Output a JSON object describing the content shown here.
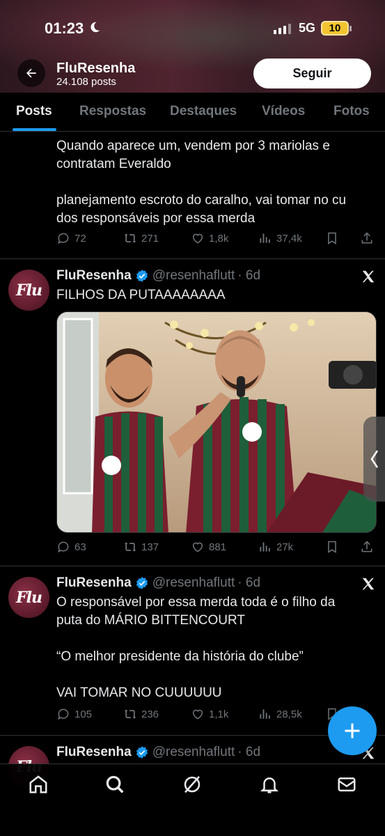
{
  "status_bar": {
    "time": "01:23",
    "network": "5G",
    "battery": "10"
  },
  "header": {
    "name": "FluResenha",
    "posts": "24.108 posts",
    "follow_label": "Seguir"
  },
  "tabs": [
    "Posts",
    "Respostas",
    "Destaques",
    "Vídeos",
    "Fotos"
  ],
  "posts": [
    {
      "lines": [
        "Quando aparece um, vendem por 3 mariolas e",
        "contratam Everaldo",
        "",
        "planejamento escroto do caralho, vai tomar no cu",
        "dos responsáveis por essa merda"
      ],
      "replies": "72",
      "reposts": "271",
      "likes": "1,8k",
      "views": "37,4k"
    },
    {
      "name": "FluResenha",
      "handle": "@resenhaflutt",
      "time": "· 6d",
      "lines": [
        "FILHOS DA PUTAAAAAAAA"
      ],
      "replies": "63",
      "reposts": "137",
      "likes": "881",
      "views": "27k",
      "media_description": "photo"
    },
    {
      "name": "FluResenha",
      "handle": "@resenhaflutt",
      "time": "· 6d",
      "lines": [
        "O responsável por essa merda toda é o filho da",
        "puta do MÁRIO BITTENCOURT",
        "",
        "“O melhor presidente da história do clube”",
        "",
        "VAI TOMAR NO CUUUUUU"
      ],
      "replies": "105",
      "reposts": "236",
      "likes": "1,1k",
      "views": "28,5k"
    },
    {
      "name": "FluResenha",
      "handle": "@resenhaflutt",
      "time": "· 6d"
    }
  ],
  "avatar_text": "Flu",
  "colors": {
    "accent": "#1d9bf0",
    "background": "#000000",
    "muted": "#71767b",
    "text": "#e7e9ea",
    "verified": "#1d9bf0"
  },
  "icons": [
    "back-arrow-icon",
    "verified-badge-icon",
    "x-logo-icon",
    "reply-icon",
    "repost-icon",
    "like-icon",
    "views-icon",
    "bookmark-icon",
    "share-icon",
    "home-icon",
    "search-icon",
    "grok-icon",
    "bell-icon",
    "mail-icon",
    "plus-icon"
  ]
}
